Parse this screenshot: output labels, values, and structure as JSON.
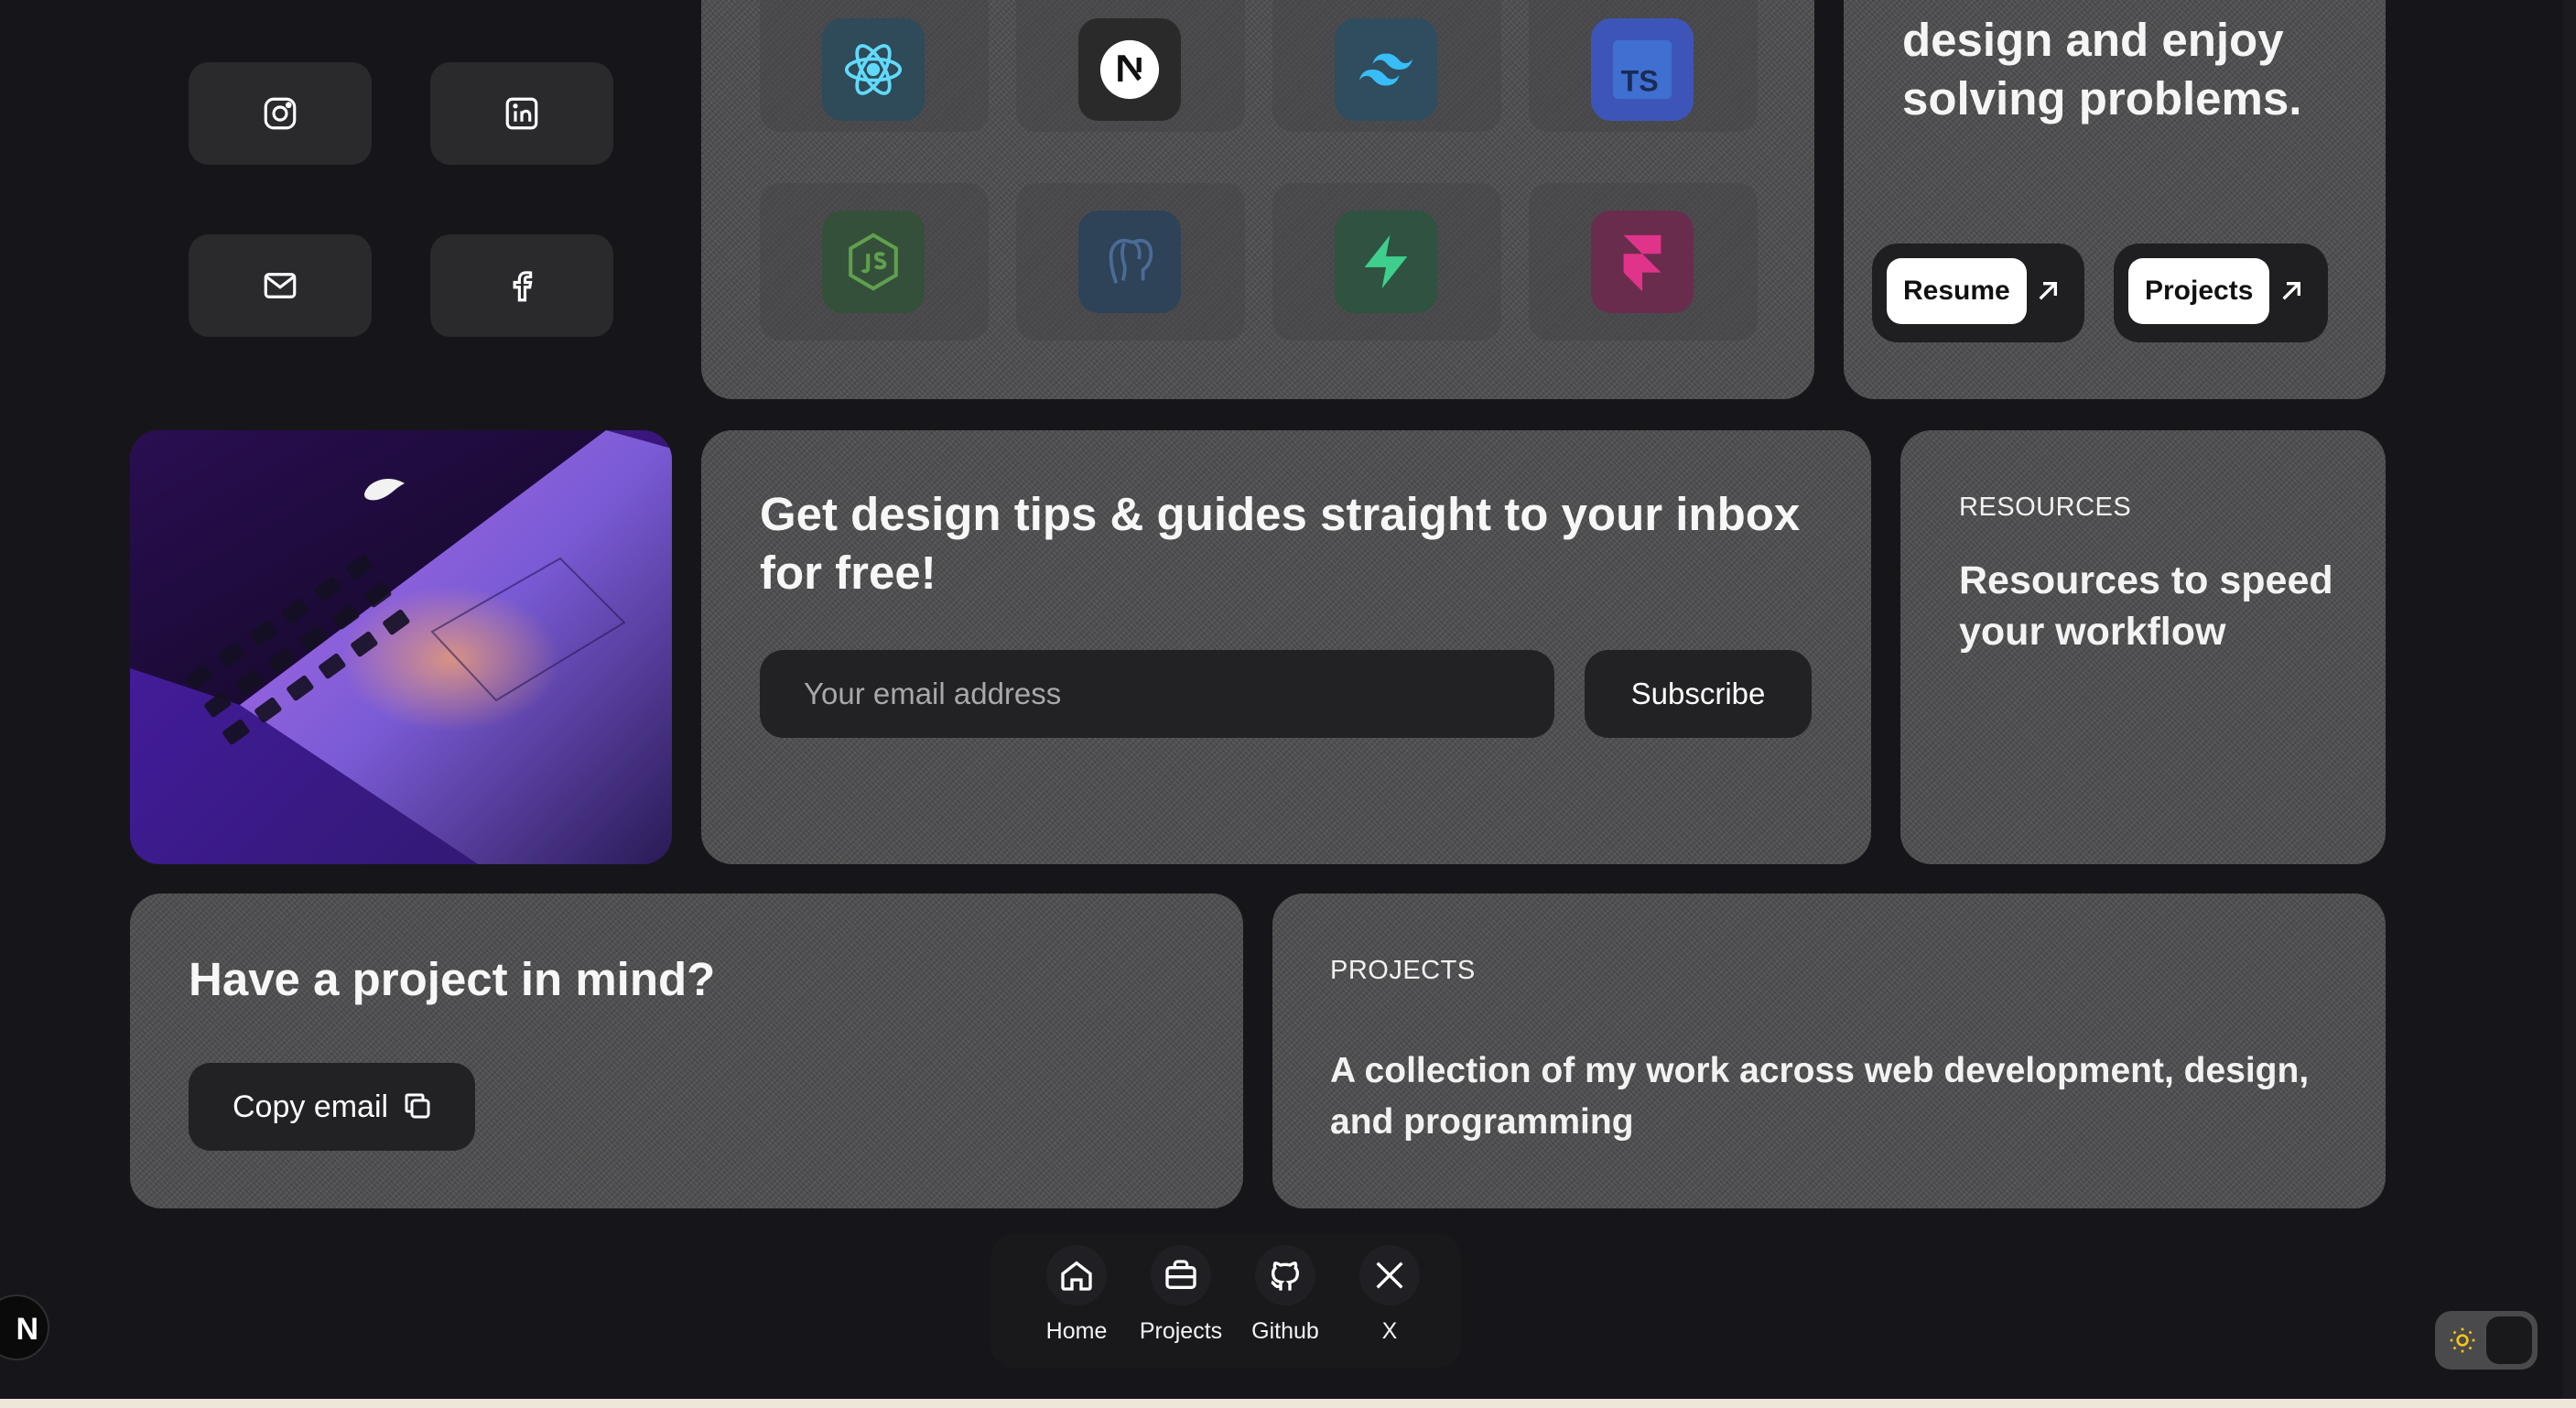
{
  "social": [
    {
      "name": "instagram",
      "icon": "instagram-icon"
    },
    {
      "name": "linkedin",
      "icon": "linkedin-icon"
    },
    {
      "name": "email",
      "icon": "mail-icon"
    },
    {
      "name": "facebook",
      "icon": "facebook-icon"
    }
  ],
  "tech_stack": [
    {
      "name": "react",
      "icon": "react-icon",
      "color": "#61dafb"
    },
    {
      "name": "nextjs",
      "icon": "nextjs-icon",
      "color": "#ffffff"
    },
    {
      "name": "tailwind",
      "icon": "tailwind-icon",
      "color": "#38bdf8"
    },
    {
      "name": "typescript",
      "icon": "typescript-icon",
      "color": "#3178c6"
    },
    {
      "name": "nodejs",
      "icon": "nodejs-icon",
      "color": "#5fa04e"
    },
    {
      "name": "postgresql",
      "icon": "postgresql-icon",
      "color": "#336791"
    },
    {
      "name": "supabase",
      "icon": "supabase-icon",
      "color": "#3ecf8e"
    },
    {
      "name": "framer",
      "icon": "framer-icon",
      "color": "#e0348a"
    }
  ],
  "about": {
    "text_line1": "design and enjoy",
    "text_line2": "solving problems.",
    "resume_label": "Resume",
    "projects_label": "Projects"
  },
  "newsletter": {
    "title": "Get design tips & guides straight to your inbox for free!",
    "email_placeholder": "Your email address",
    "subscribe_label": "Subscribe"
  },
  "resources": {
    "eyebrow": "RESOURCES",
    "title": "Resources to speed your workflow"
  },
  "cta": {
    "title": "Have a project in mind?",
    "copy_email_label": "Copy email"
  },
  "projects": {
    "eyebrow": "PROJECTS",
    "description": "A collection of my work across web development, design, and programming"
  },
  "dock": {
    "items": [
      {
        "label": "Home",
        "icon": "home-icon"
      },
      {
        "label": "Projects",
        "icon": "briefcase-icon"
      },
      {
        "label": "Github",
        "icon": "github-icon"
      },
      {
        "label": "X",
        "icon": "x-logo-icon"
      }
    ]
  },
  "badge": {
    "text": "N"
  },
  "colors": {
    "background": "#16161a",
    "card": "#4e4e50",
    "button_dark": "#222225",
    "accent_sun": "#f5c518"
  }
}
